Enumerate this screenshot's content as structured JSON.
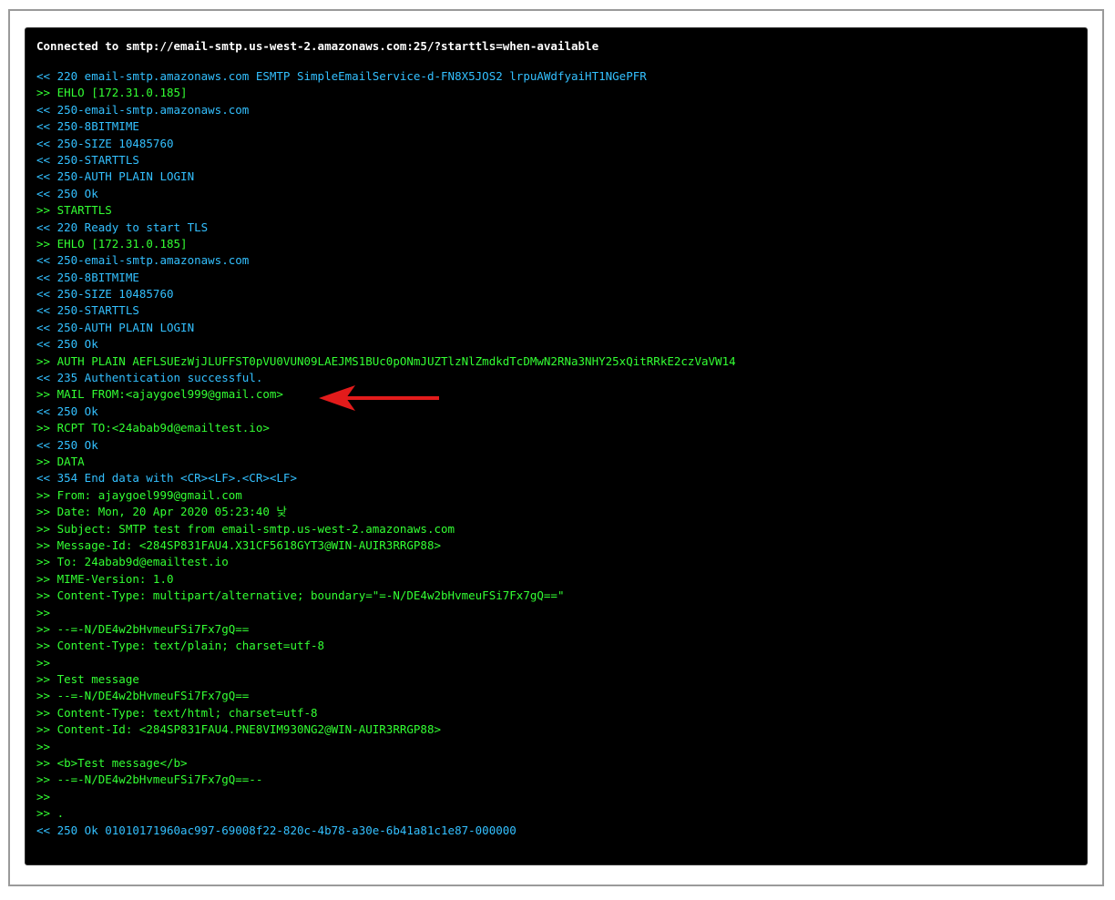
{
  "terminal": {
    "connection_header": "Connected to smtp://email-smtp.us-west-2.amazonaws.com:25/?starttls=when-available",
    "colors": {
      "background": "#000000",
      "header_text": "#ffffff",
      "server_response": "#33c0ff",
      "client_command": "#33ff33",
      "annotation_arrow": "#e31b1b"
    },
    "lines": [
      {
        "dir": "in",
        "text": "<< 220 email-smtp.amazonaws.com ESMTP SimpleEmailService-d-FN8X5JOS2 lrpuAWdfyaiHT1NGePFR"
      },
      {
        "dir": "out",
        "text": ">> EHLO [172.31.0.185]"
      },
      {
        "dir": "in",
        "text": "<< 250-email-smtp.amazonaws.com"
      },
      {
        "dir": "in",
        "text": "<< 250-8BITMIME"
      },
      {
        "dir": "in",
        "text": "<< 250-SIZE 10485760"
      },
      {
        "dir": "in",
        "text": "<< 250-STARTTLS"
      },
      {
        "dir": "in",
        "text": "<< 250-AUTH PLAIN LOGIN"
      },
      {
        "dir": "in",
        "text": "<< 250 Ok"
      },
      {
        "dir": "out",
        "text": ">> STARTTLS"
      },
      {
        "dir": "in",
        "text": "<< 220 Ready to start TLS"
      },
      {
        "dir": "out",
        "text": ">> EHLO [172.31.0.185]"
      },
      {
        "dir": "in",
        "text": "<< 250-email-smtp.amazonaws.com"
      },
      {
        "dir": "in",
        "text": "<< 250-8BITMIME"
      },
      {
        "dir": "in",
        "text": "<< 250-SIZE 10485760"
      },
      {
        "dir": "in",
        "text": "<< 250-STARTTLS"
      },
      {
        "dir": "in",
        "text": "<< 250-AUTH PLAIN LOGIN"
      },
      {
        "dir": "in",
        "text": "<< 250 Ok"
      },
      {
        "dir": "out",
        "text": ">> AUTH PLAIN AEFLSUEzWjJLUFFST0pVU0VUN09LAEJMS1BUc0pONmJUZTlzNlZmdkdTcDMwN2RNa3NHY25xQitRRkE2czVaVW14"
      },
      {
        "dir": "in",
        "text": "<< 235 Authentication successful."
      },
      {
        "dir": "out",
        "text": ">> MAIL FROM:<ajaygoel999@gmail.com>"
      },
      {
        "dir": "in",
        "text": "<< 250 Ok"
      },
      {
        "dir": "out",
        "text": ">> RCPT TO:<24abab9d@emailtest.io>"
      },
      {
        "dir": "in",
        "text": "<< 250 Ok"
      },
      {
        "dir": "out",
        "text": ">> DATA"
      },
      {
        "dir": "in",
        "text": "<< 354 End data with <CR><LF>.<CR><LF>"
      },
      {
        "dir": "out",
        "text": ">> From: ajaygoel999@gmail.com"
      },
      {
        "dir": "out",
        "text": ">> Date: Mon, 20 Apr 2020 05:23:40 낮"
      },
      {
        "dir": "out",
        "text": ">> Subject: SMTP test from email-smtp.us-west-2.amazonaws.com"
      },
      {
        "dir": "out",
        "text": ">> Message-Id: <284SP831FAU4.X31CF5618GYT3@WIN-AUIR3RRGP88>"
      },
      {
        "dir": "out",
        "text": ">> To: 24abab9d@emailtest.io"
      },
      {
        "dir": "out",
        "text": ">> MIME-Version: 1.0"
      },
      {
        "dir": "out",
        "text": ">> Content-Type: multipart/alternative; boundary=\"=-N/DE4w2bHvmeuFSi7Fx7gQ==\""
      },
      {
        "dir": "out",
        "text": ">>"
      },
      {
        "dir": "out",
        "text": ">> --=-N/DE4w2bHvmeuFSi7Fx7gQ=="
      },
      {
        "dir": "out",
        "text": ">> Content-Type: text/plain; charset=utf-8"
      },
      {
        "dir": "out",
        "text": ">>"
      },
      {
        "dir": "out",
        "text": ">> Test message"
      },
      {
        "dir": "out",
        "text": ">> --=-N/DE4w2bHvmeuFSi7Fx7gQ=="
      },
      {
        "dir": "out",
        "text": ">> Content-Type: text/html; charset=utf-8"
      },
      {
        "dir": "out",
        "text": ">> Content-Id: <284SP831FAU4.PNE8VIM930NG2@WIN-AUIR3RRGP88>"
      },
      {
        "dir": "out",
        "text": ">>"
      },
      {
        "dir": "out",
        "text": ">> <b>Test message</b>"
      },
      {
        "dir": "out",
        "text": ">> --=-N/DE4w2bHvmeuFSi7Fx7gQ==--"
      },
      {
        "dir": "out",
        "text": ">>"
      },
      {
        "dir": "out",
        "text": ">> ."
      },
      {
        "dir": "in",
        "text": "<< 250 Ok 01010171960ac997-69008f22-820c-4b78-a30e-6b41a81c1e87-000000"
      }
    ]
  },
  "annotation": {
    "icon": "left-arrow-icon",
    "target_line": ">> MAIL FROM:<ajaygoel999@gmail.com>"
  }
}
